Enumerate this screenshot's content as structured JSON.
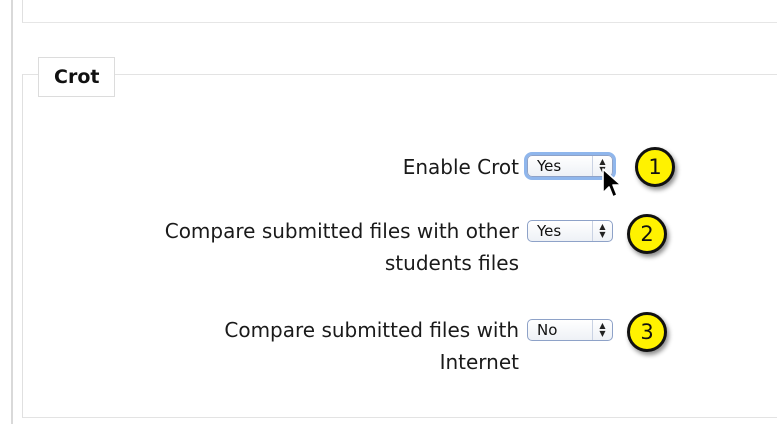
{
  "section": {
    "title": "Crot"
  },
  "settings": [
    {
      "label_line1": "Enable Crot",
      "label_line2": "",
      "value": "Yes",
      "callout": "1"
    },
    {
      "label_line1": "Compare submitted files with other",
      "label_line2": "students files",
      "value": "Yes",
      "callout": "2"
    },
    {
      "label_line1": "Compare submitted files with",
      "label_line2": "Internet",
      "value": "No",
      "callout": "3"
    }
  ],
  "colors": {
    "callout_fill": "#fff200",
    "select_border": "#8ea2c8",
    "focus_ring": "#8fb6ec"
  },
  "icons": [
    "select-arrows-icon",
    "mouse-pointer-icon"
  ]
}
